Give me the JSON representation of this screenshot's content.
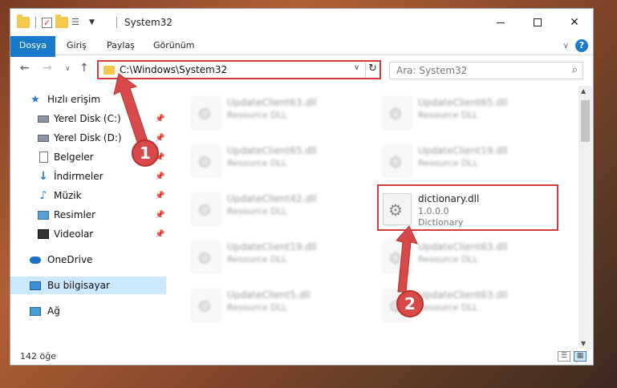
{
  "window": {
    "title": "System32",
    "minimize_glyph": "—",
    "close_glyph": "✕"
  },
  "ribbon": {
    "tabs": [
      "Dosya",
      "Giriş",
      "Paylaş",
      "Görünüm"
    ],
    "help_glyph": "?"
  },
  "nav": {
    "address": "C:\\Windows\\System32",
    "search_placeholder": "Ara: System32"
  },
  "sidebar": {
    "quick_access": "Hızlı erişim",
    "items": [
      {
        "label": "Yerel Disk (C:)",
        "icon": "drive-icon",
        "pinned": true
      },
      {
        "label": "Yerel Disk (D:)",
        "icon": "drive-icon",
        "pinned": true
      },
      {
        "label": "Belgeler",
        "icon": "documents-icon",
        "pinned": true
      },
      {
        "label": "İndirmeler",
        "icon": "download-icon",
        "pinned": true
      },
      {
        "label": "Müzik",
        "icon": "music-icon",
        "pinned": true
      },
      {
        "label": "Resimler",
        "icon": "pictures-icon",
        "pinned": true
      },
      {
        "label": "Videolar",
        "icon": "videos-icon",
        "pinned": true
      }
    ],
    "onedrive": "OneDrive",
    "this_pc": "Bu bilgisayar",
    "network": "Ağ"
  },
  "files": [
    {
      "name": "UpdateClient63.dll",
      "desc": "Resource DLL"
    },
    {
      "name": "UpdateClient65.dll",
      "desc": "Resource DLL"
    },
    {
      "name": "UpdateClient65.dll",
      "desc": "Resource DLL"
    },
    {
      "name": "UpdateClient19.dll",
      "desc": "Resource DLL"
    },
    {
      "name": "UpdateClient42.dll",
      "desc": "Resource DLL"
    },
    {
      "name": "dictionary.dll",
      "version": "1.0.0.0",
      "desc": "Dictionary"
    },
    {
      "name": "UpdateClient19.dll",
      "desc": "Resource DLL"
    },
    {
      "name": "UpdateClient63.dll",
      "desc": "Resource DLL"
    },
    {
      "name": "UpdateClient5.dll",
      "desc": "Resource DLL"
    },
    {
      "name": "UpdateClient63.dll",
      "desc": "Resource DLL"
    }
  ],
  "status": {
    "count": "142 öğe"
  },
  "annotations": {
    "step1": "1",
    "step2": "2",
    "color": "#d84a4a"
  }
}
